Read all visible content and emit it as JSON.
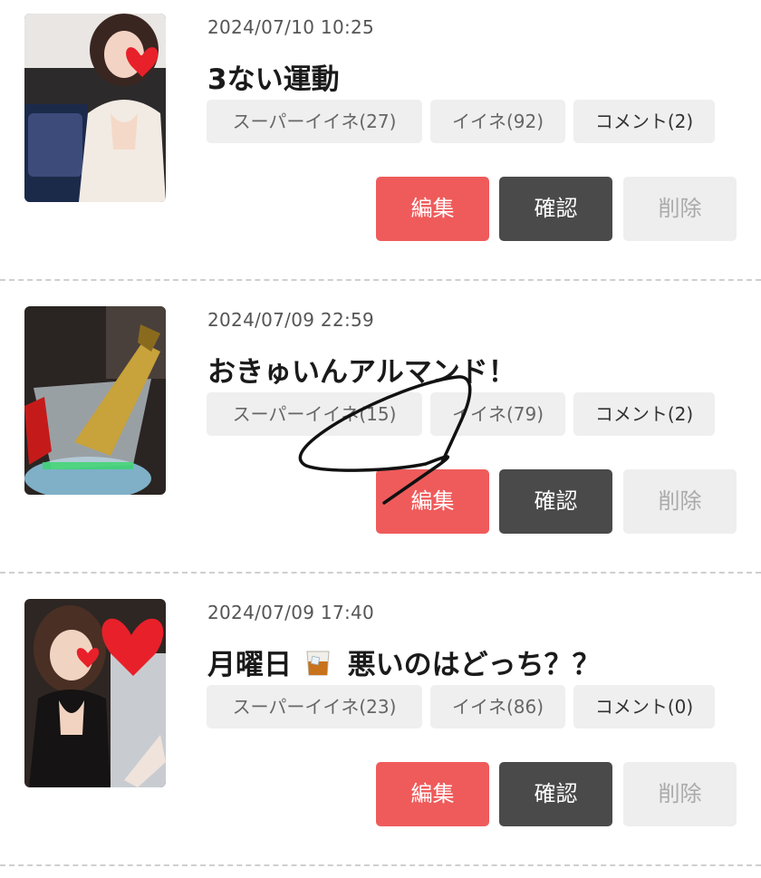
{
  "posts": [
    {
      "date": "2024/07/10 10:25",
      "title": "3ない運動",
      "title_emoji": "",
      "title_suffix": "",
      "super_like": "スーパーイイネ(27)",
      "like": "イイネ(92)",
      "comment": "コメント(2)",
      "thumbnail": "photo-woman-with-bag",
      "buttons": {
        "edit": "編集",
        "confirm": "確認",
        "delete": "削除"
      }
    },
    {
      "date": "2024/07/09 22:59",
      "title": "おきゅいんアルマンド！",
      "title_emoji": "",
      "title_suffix": "",
      "super_like": "スーパーイイネ(15)",
      "like": "イイネ(79)",
      "comment": "コメント(2)",
      "thumbnail": "photo-champagne-bucket",
      "buttons": {
        "edit": "編集",
        "confirm": "確認",
        "delete": "削除"
      }
    },
    {
      "date": "2024/07/09 17:40",
      "title": "月曜日",
      "title_emoji": "glass-icon",
      "title_suffix": "悪いのはどっち？？",
      "super_like": "スーパーイイネ(23)",
      "like": "イイネ(86)",
      "comment": "コメント(0)",
      "thumbnail": "photo-couple",
      "buttons": {
        "edit": "編集",
        "confirm": "確認",
        "delete": "削除"
      }
    }
  ],
  "colors": {
    "edit_button": "#ef5b5b",
    "confirm_button": "#4a4a4a",
    "delete_button": "#eeeeee",
    "stat_background": "#efefef",
    "annotation_stroke": "#111111"
  }
}
